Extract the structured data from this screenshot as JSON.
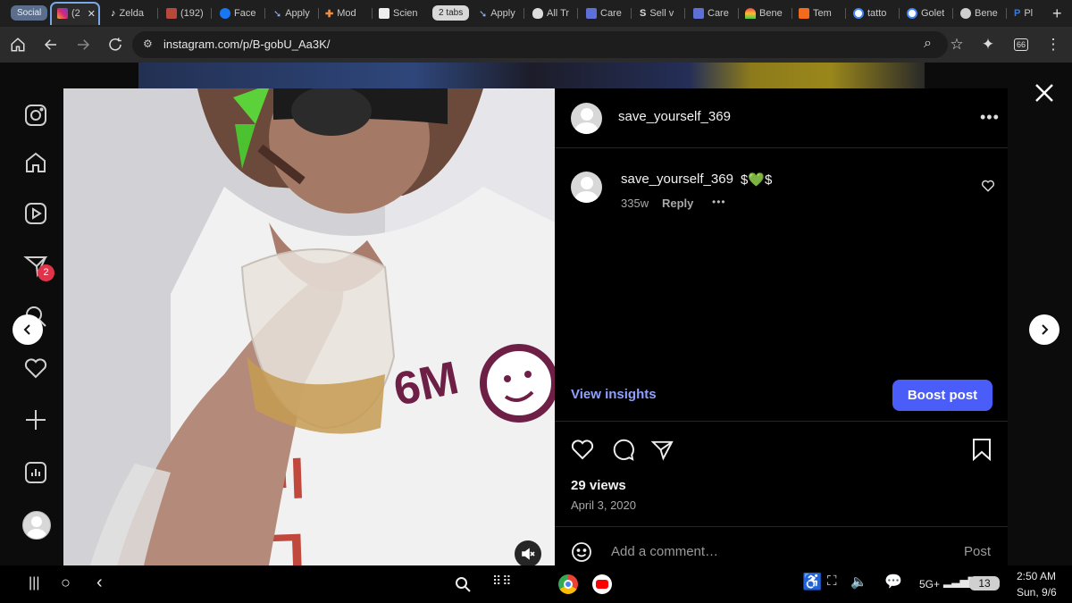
{
  "browser": {
    "tabs": [
      {
        "label": "Social",
        "kind": "group"
      },
      {
        "label": "(2",
        "active": true
      },
      {
        "label": "Zelda"
      },
      {
        "label": "(192)"
      },
      {
        "label": "Face"
      },
      {
        "label": "Apply"
      },
      {
        "label": "Mod"
      },
      {
        "label": "Scien"
      },
      {
        "label": "2 tabs",
        "kind": "group"
      },
      {
        "label": "Apply"
      },
      {
        "label": "All Tr"
      },
      {
        "label": "Care"
      },
      {
        "label": "Sell v"
      },
      {
        "label": "Care"
      },
      {
        "label": "Bene"
      },
      {
        "label": "Tem"
      },
      {
        "label": "tatto"
      },
      {
        "label": "Golet"
      },
      {
        "label": "Bene"
      },
      {
        "label": "Pl"
      }
    ],
    "new_tab": "+",
    "url": "instagram.com/p/B-gobU_Aa3K/",
    "extension_badge": "66"
  },
  "post": {
    "author": "save_yourself_369",
    "comment": {
      "user": "save_yourself_369",
      "text": "$💚$",
      "age": "335w",
      "reply": "Reply"
    },
    "view_insights": "View insights",
    "boost": "Boost post",
    "views": "29 views",
    "date": "April 3, 2020",
    "comment_placeholder": "Add a comment…",
    "post_button": "Post",
    "shirt_text_top": "6M",
    "shirt_text_mid": "lnsun",
    "shirt_text_low": "Lunch"
  },
  "nav": {
    "notifications_badge": "2"
  },
  "taskbar": {
    "network": "5G+",
    "battery": "13",
    "time": "2:50 AM",
    "date": "Sun, 9/6"
  },
  "colors": {
    "accent": "#4a5df9",
    "link": "#8fa1ff",
    "badge": "#e0344a"
  }
}
